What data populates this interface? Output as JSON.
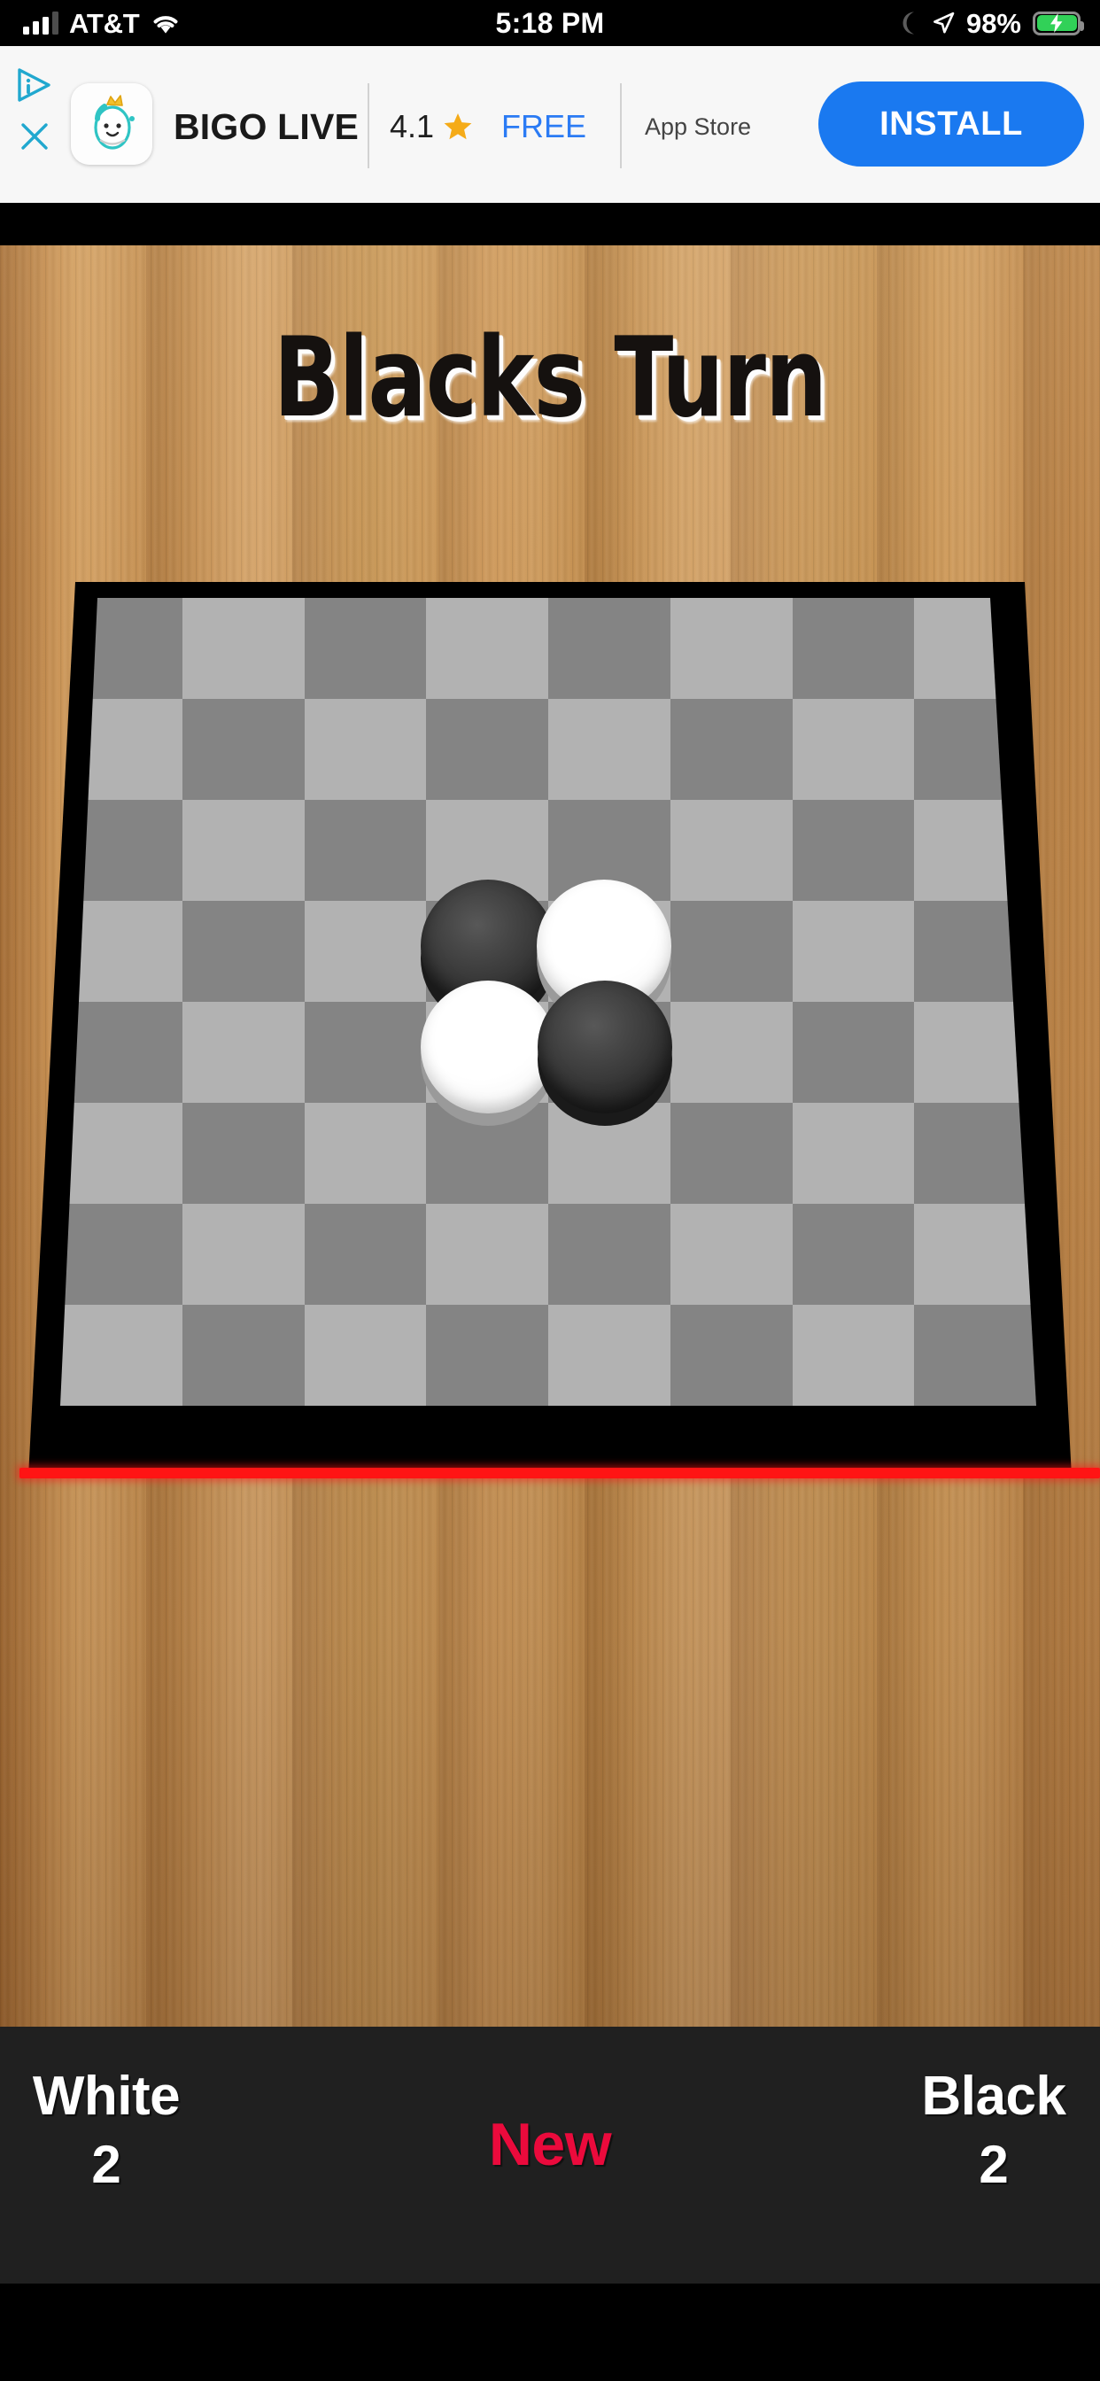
{
  "status_bar": {
    "carrier": "AT&T",
    "time": "5:18 PM",
    "battery_percent": "98%",
    "signal_icon": "signal-bars-icon",
    "wifi_icon": "wifi-icon",
    "dnd_icon": "moon-icon",
    "location_icon": "location-arrow-icon",
    "battery_icon": "battery-charging-icon",
    "battery_color": "#31d158"
  },
  "ad_banner": {
    "adchoices_icon": "adchoices-icon",
    "close_icon": "close-icon",
    "app_icon": "bigo-live-app-icon",
    "app_name": "BIGO LIVE",
    "rating": "4.1",
    "star_icon": "star-icon",
    "price": "FREE",
    "store": "App Store",
    "install_label": "INSTALL",
    "install_color": "#1a79f0",
    "price_color": "#2b7bf4"
  },
  "game": {
    "turn_title": "Blacks Turn",
    "board": {
      "rows": 8,
      "cols": 8,
      "light_color": "#b2b2b2",
      "dark_color": "#848484",
      "frame_color": "#000000",
      "accent_line_color": "#ff1414",
      "pieces": [
        {
          "row": 3,
          "col": 3,
          "color": "black"
        },
        {
          "row": 3,
          "col": 4,
          "color": "white"
        },
        {
          "row": 4,
          "col": 3,
          "color": "white"
        },
        {
          "row": 4,
          "col": 4,
          "color": "black"
        }
      ]
    }
  },
  "bottom_bar": {
    "white_label": "White",
    "white_score": "2",
    "black_label": "Black",
    "black_score": "2",
    "new_game_label": "New",
    "new_game_color": "#eb0a3c"
  }
}
